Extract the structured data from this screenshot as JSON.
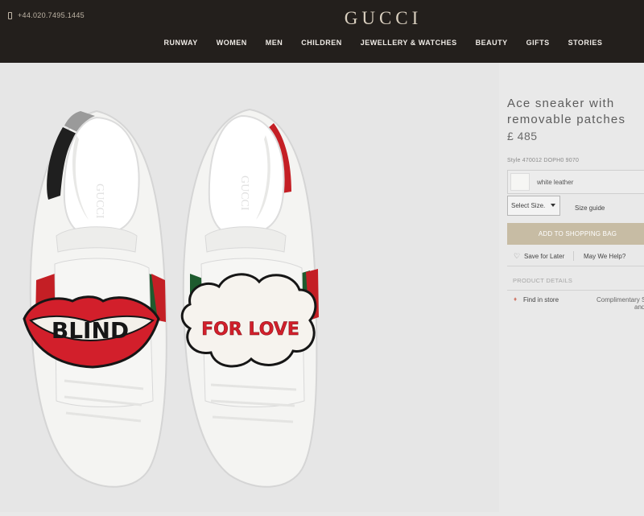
{
  "header": {
    "phone": "+44.020.7495.1445",
    "logo": "GUCCI",
    "nav": [
      "RUNWAY",
      "WOMEN",
      "MEN",
      "CHILDREN",
      "JEWELLERY & WATCHES",
      "BEAUTY",
      "GIFTS",
      "STORIES"
    ]
  },
  "product": {
    "title_line1": "Ace sneaker with",
    "title_line2": "removable patches",
    "price": "£ 485",
    "style": "Style 470012 DOPH0 9070",
    "color": "white leather",
    "size_select": "Select Size.",
    "size_guide": "Size guide",
    "add_to_bag": "ADD TO SHOPPING BAG",
    "save_for_later": "Save for Later",
    "may_we_help": "May We Help?",
    "product_details": "PRODUCT DETAILS",
    "find_in_store": "Find in store",
    "complimentary_line1": "Complimentary S",
    "complimentary_line2": "and",
    "patch_left": "BLIND",
    "patch_right": "FOR LOVE"
  },
  "colors": {
    "header_bg": "#231f1c",
    "accent": "#c7bca4",
    "patch_red": "#d21f2b"
  }
}
